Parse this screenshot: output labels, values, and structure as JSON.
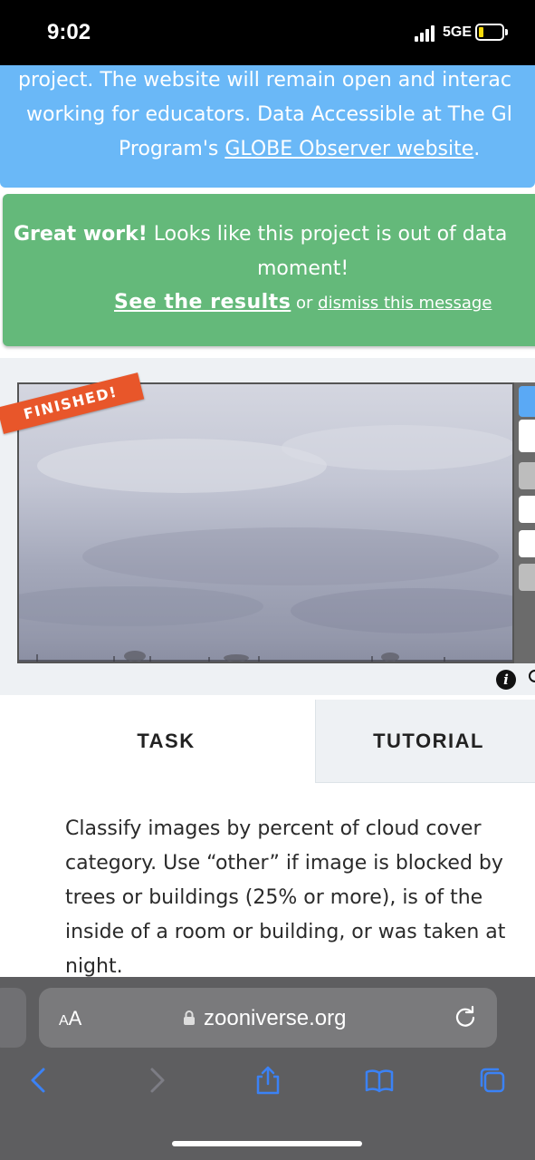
{
  "status_bar": {
    "time": "9:02",
    "network": "5GE"
  },
  "blue_banner": {
    "line1": "project. The website will remain open and interac",
    "line2": "working for educators. Data Accessible at The Gl",
    "line3_prefix": "Program's ",
    "line3_link": "GLOBE Observer website",
    "line3_suffix": "."
  },
  "green_banner": {
    "bold": "Great work!",
    "text": " Looks like this project is out of data",
    "line2": "moment!",
    "results_link": "See the results",
    "or": " or ",
    "dismiss_link": "dismiss this message"
  },
  "viewer": {
    "ribbon": "FINISHED!"
  },
  "task_tabs": {
    "task": "TASK",
    "tutorial": "TUTORIAL"
  },
  "task_text": [
    "Classify images by percent of cloud cover",
    "category. Use “other” if image is blocked by",
    "trees or buildings (25% or more), is of the",
    "inside of a room or building, or was taken at",
    "night."
  ],
  "safari": {
    "aa_big": "A",
    "aa_small": "A",
    "url": "zooniverse.org"
  },
  "colors": {
    "blue_banner": "#6ab8f7",
    "green_banner": "#64b97a",
    "ribbon": "#e8562a",
    "safari": "#5e5e60",
    "ios_blue": "#3b82f6"
  },
  "icons": [
    "info-icon",
    "lock-icon",
    "reload-icon",
    "back-icon",
    "forward-icon",
    "share-icon",
    "bookmarks-icon",
    "tabs-icon"
  ]
}
